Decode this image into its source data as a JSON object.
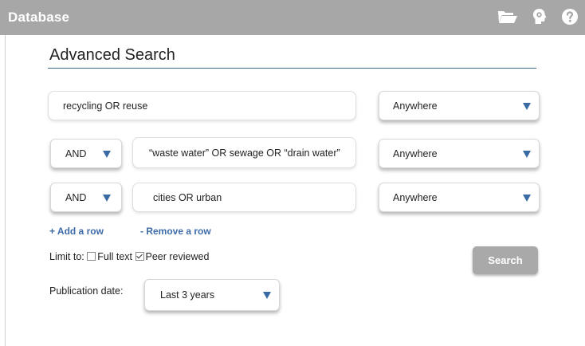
{
  "app": {
    "title": "Database"
  },
  "page": {
    "title": "Advanced Search"
  },
  "rows": [
    {
      "operator": null,
      "query": "recycling OR reuse",
      "field": "Anywhere"
    },
    {
      "operator": "AND",
      "query": "“waste water” OR sewage OR “drain water”",
      "field": "Anywhere"
    },
    {
      "operator": "AND",
      "query": "cities OR urban",
      "field": "Anywhere"
    }
  ],
  "actions": {
    "add_row": "+ Add a row",
    "remove_row": "- Remove a row"
  },
  "limit": {
    "label": "Limit to:",
    "full_text": {
      "label": "Full text",
      "checked": false
    },
    "peer_reviewed": {
      "label": "Peer reviewed",
      "checked": true
    }
  },
  "search_button": "Search",
  "publication_date": {
    "label": "Publication date:",
    "value": "Last 3 years"
  },
  "icons": [
    "folder-open-icon",
    "head-gear-icon",
    "help-icon"
  ],
  "colors": {
    "topbar": "#a7a7a7",
    "accent": "#3d6ba8",
    "rule": "#3c6781",
    "button": "#a9a9a9"
  }
}
